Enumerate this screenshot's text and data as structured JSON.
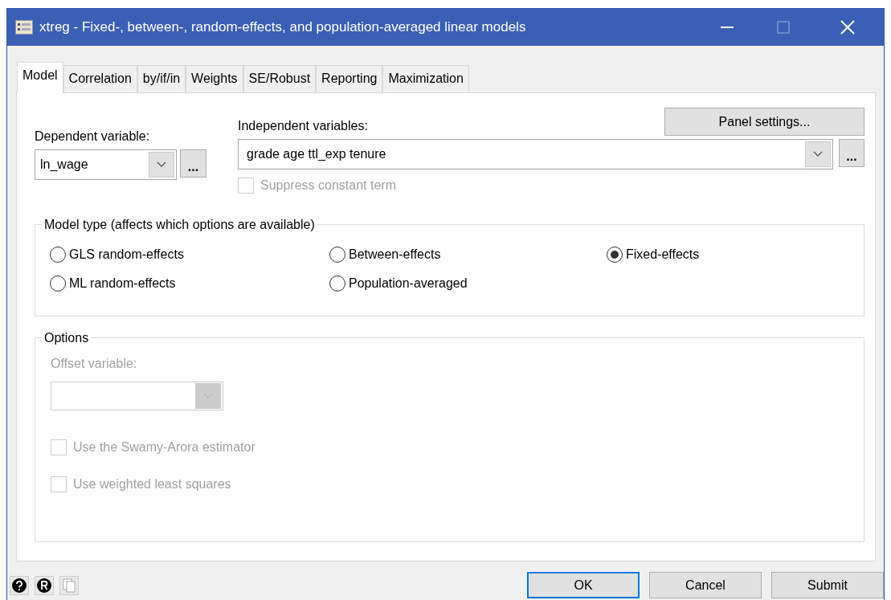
{
  "window": {
    "title": "xtreg - Fixed-, between-, random-effects, and population-averaged linear models",
    "controls": [
      {
        "kind": "minimize",
        "disabled": false
      },
      {
        "kind": "maximize",
        "disabled": true
      },
      {
        "kind": "close",
        "disabled": false
      }
    ]
  },
  "tabs": [
    {
      "label": "Model",
      "selected": true
    },
    {
      "label": "Correlation",
      "selected": false
    },
    {
      "label": "by/if/in",
      "selected": false
    },
    {
      "label": "Weights",
      "selected": false
    },
    {
      "label": "SE/Robust",
      "selected": false
    },
    {
      "label": "Reporting",
      "selected": false
    },
    {
      "label": "Maximization",
      "selected": false
    }
  ],
  "panel_settings_button": "Panel settings...",
  "dependent_variable": {
    "label": "Dependent variable:",
    "value": "ln_wage",
    "browse": "..."
  },
  "independent_variables": {
    "label": "Independent variables:",
    "value": "grade age ttl_exp tenure",
    "browse": "..."
  },
  "suppress_constant": {
    "label": "Suppress constant term",
    "checked": false,
    "disabled": true
  },
  "model_type": {
    "title": "Model type (affects which options are available)",
    "options": [
      {
        "label": "GLS random-effects",
        "selected": false
      },
      {
        "label": "Between-effects",
        "selected": false
      },
      {
        "label": "Fixed-effects",
        "selected": true
      },
      {
        "label": "ML random-effects",
        "selected": false
      },
      {
        "label": "Population-averaged",
        "selected": false
      }
    ]
  },
  "options": {
    "title": "Options",
    "offset_variable": {
      "label": "Offset variable:",
      "disabled": true
    },
    "checkboxes": [
      {
        "label": "Use the Swamy-Arora estimator",
        "checked": false,
        "disabled": true
      },
      {
        "label": "Use weighted least squares",
        "checked": false,
        "disabled": true
      }
    ]
  },
  "footer": {
    "icons": [
      {
        "kind": "help",
        "disabled": false
      },
      {
        "kind": "reset",
        "disabled": false
      },
      {
        "kind": "copy",
        "disabled": true
      }
    ],
    "buttons": [
      {
        "label": "OK",
        "default": true
      },
      {
        "label": "Cancel",
        "default": false
      },
      {
        "label": "Submit",
        "default": false
      }
    ]
  }
}
